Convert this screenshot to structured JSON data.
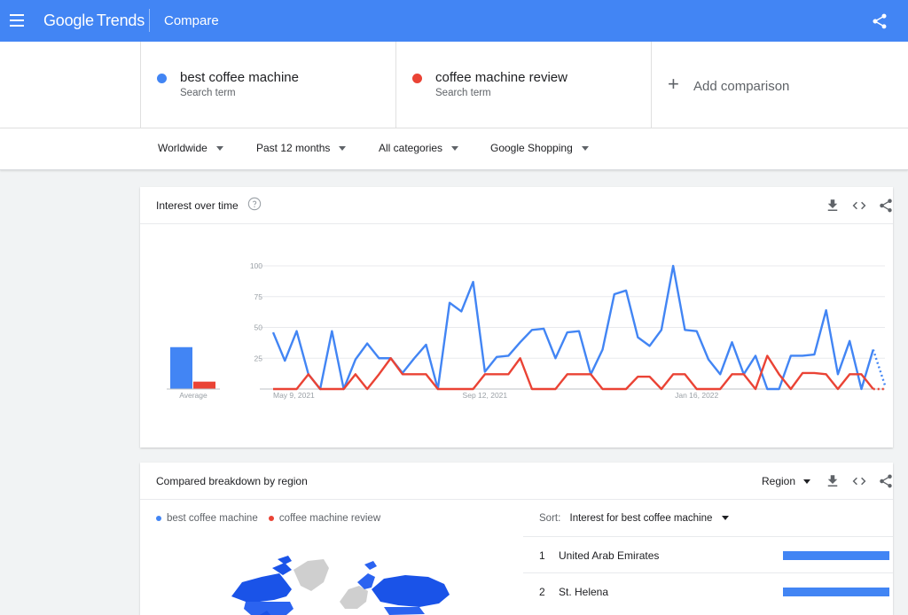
{
  "header": {
    "logo_google": "Google",
    "logo_trends": "Trends",
    "page_name": "Compare"
  },
  "terms": [
    {
      "name": "best coffee machine",
      "sub": "Search term",
      "color": "#4285f4"
    },
    {
      "name": "coffee machine review",
      "sub": "Search term",
      "color": "#ea4335"
    }
  ],
  "add_comparison": "Add comparison",
  "filters": {
    "region": "Worldwide",
    "time": "Past 12 months",
    "category": "All categories",
    "property": "Google Shopping"
  },
  "interest_card": {
    "title": "Interest over time",
    "average_label": "Average"
  },
  "chart_data": {
    "type": "line",
    "y_ticks": [
      25,
      50,
      75,
      100
    ],
    "ylim": [
      0,
      100
    ],
    "x_tick_labels": [
      {
        "label": "May 9, 2021",
        "index": 0
      },
      {
        "label": "Sep 12, 2021",
        "index": 18
      },
      {
        "label": "Jan 16, 2022",
        "index": 36
      }
    ],
    "series": [
      {
        "name": "best coffee machine",
        "color": "#4285f4",
        "average": 34,
        "values": [
          46,
          23,
          47,
          12,
          0,
          47,
          0,
          24,
          37,
          25,
          25,
          13,
          25,
          36,
          0,
          70,
          63,
          87,
          14,
          26,
          27,
          38,
          48,
          49,
          25,
          46,
          47,
          12,
          32,
          77,
          80,
          42,
          35,
          48,
          100,
          48,
          47,
          24,
          12,
          38,
          12,
          27,
          0,
          0,
          27,
          27,
          28,
          64,
          12,
          39,
          0,
          32,
          3
        ]
      },
      {
        "name": "coffee machine review",
        "color": "#ea4335",
        "average": 6,
        "values": [
          0,
          0,
          0,
          12,
          0,
          0,
          0,
          12,
          0,
          12,
          25,
          12,
          12,
          12,
          0,
          0,
          0,
          0,
          12,
          12,
          12,
          25,
          0,
          0,
          0,
          12,
          12,
          12,
          0,
          0,
          0,
          10,
          10,
          0,
          12,
          12,
          0,
          0,
          0,
          12,
          12,
          0,
          27,
          12,
          0,
          13,
          13,
          12,
          0,
          12,
          12,
          0,
          0
        ]
      }
    ]
  },
  "region_card": {
    "title": "Compared breakdown by region",
    "selector": "Region",
    "legend": [
      "best coffee machine",
      "coffee machine review"
    ],
    "sort_label": "Sort:",
    "sort_value": "Interest for best coffee machine",
    "ranks": [
      {
        "rank": "1",
        "name": "United Arab Emirates",
        "value": 100
      },
      {
        "rank": "2",
        "name": "St. Helena",
        "value": 100
      }
    ]
  }
}
